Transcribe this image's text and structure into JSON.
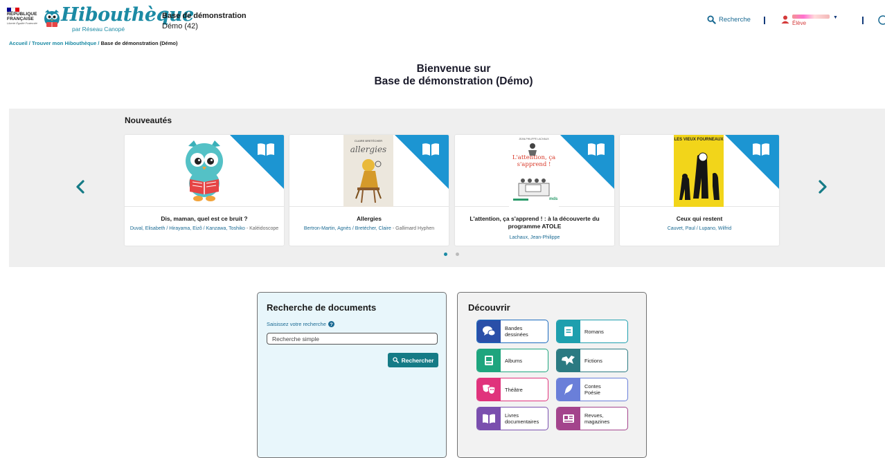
{
  "header": {
    "republic_line1": "RÉPUBLIQUE",
    "republic_line2": "FRANÇAISE",
    "motto": "Liberté Égalité Fraternité",
    "brand": "Hibouthèque",
    "brand_sub": "par Réseau Canopé",
    "base_title": "Base de démonstration",
    "base_sub": "Démo (42)",
    "search_label": "Recherche",
    "user_role": "Élève",
    "colors": {
      "flag_blue": "#000091",
      "flag_red": "#e1000f",
      "brand": "#1b8aa4"
    }
  },
  "breadcrumb": {
    "items": [
      "Accueil",
      "Trouver mon Hibouthèque",
      "Base de démonstration (Démo)"
    ],
    "separator": "/"
  },
  "welcome": {
    "line1": "Bienvenue sur",
    "line2": "Base de démonstration (Démo)"
  },
  "carousel": {
    "title": "Nouveautés",
    "active_page": 1,
    "page_count": 2,
    "cards": [
      {
        "title": "Dis, maman, quel est ce bruit ?",
        "authors": "Duval, Elisabeth / Hirayama, Eizô / Kanzawa, Toshiko",
        "publisher": "Kaléidoscope",
        "cover": "owl-mascot"
      },
      {
        "title": "Allergies",
        "authors": "Bertron-Martin, Agnès / Bretécher, Claire",
        "publisher": "Gallimard Hyphen",
        "cover_author": "CLAIRE BRETÉCHER",
        "cover_title": "allergies"
      },
      {
        "title": "L'attention, ça s'apprend ! : à la découverte du programme ATOLE",
        "authors": "Lachaux, Jean-Philippe",
        "publisher": "",
        "cover_author": "JEAN-PHILIPPE LACHAUX",
        "cover_title": "L'attention, ça s'apprend !",
        "cover_brand": "mds"
      },
      {
        "title": "Ceux qui restent",
        "authors": "Cauvet, Paul / Lupano, Wilfrid",
        "publisher": "",
        "cover_title": "LES VIEUX FOURNEAUX"
      }
    ]
  },
  "search": {
    "title": "Recherche de documents",
    "label": "Saisissez votre recherche",
    "placeholder": "Recherche simple",
    "button": "Rechercher"
  },
  "discover": {
    "title": "Découvrir",
    "genres": [
      {
        "label": "Bandes\ndessinées",
        "icon": "speech-bubbles-icon",
        "color": "#2a4fa8"
      },
      {
        "label": "Romans",
        "icon": "book-icon",
        "color": "#1e9fae"
      },
      {
        "label": "Albums",
        "icon": "picture-book-icon",
        "color": "#1ea57e"
      },
      {
        "label": "Fictions",
        "icon": "dragon-icon",
        "color": "#2b7a82"
      },
      {
        "label": "Théâtre",
        "icon": "masks-icon",
        "color": "#e0337c"
      },
      {
        "label": "Contes\nPoésie",
        "icon": "feather-icon",
        "color": "#6a7fd9"
      },
      {
        "label": "Livres\ndocumentaires",
        "icon": "open-book-icon",
        "color": "#7a4fae"
      },
      {
        "label": "Revues,\nmagazines",
        "icon": "newspaper-icon",
        "color": "#a3448c"
      }
    ]
  }
}
